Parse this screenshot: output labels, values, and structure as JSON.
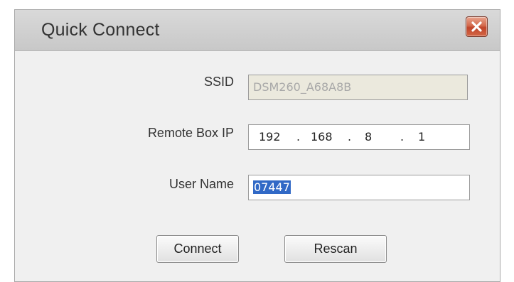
{
  "dialog": {
    "title": "Quick Connect"
  },
  "form": {
    "ssid_label": "SSID",
    "ssid_value": "DSM260_A68A8B",
    "remote_ip_label": "Remote Box IP",
    "ip_octets": [
      "192",
      "168",
      "8",
      "1"
    ],
    "ip_separator": ".",
    "username_label": "User Name",
    "username_value": "07447"
  },
  "buttons": {
    "connect_label": "Connect",
    "rescan_label": "Rescan"
  },
  "colors": {
    "selection_highlight": "#3169c6",
    "close_button": "#c0442a",
    "disabled_field": "#ebe9dd"
  },
  "icons": {
    "close": "close-icon"
  }
}
